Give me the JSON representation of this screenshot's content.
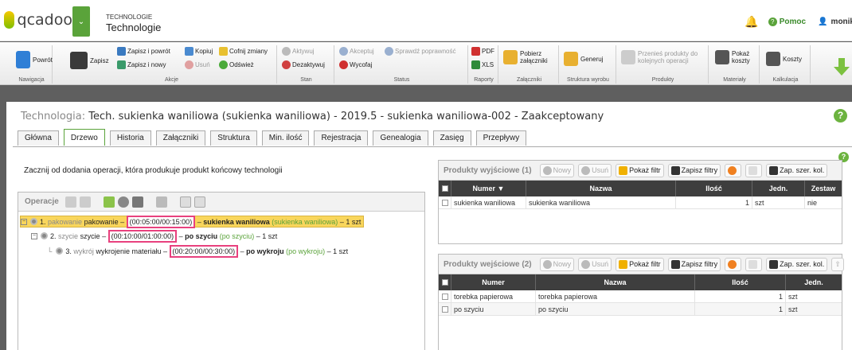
{
  "header": {
    "logo": "qcadoo",
    "category": "TECHNOLOGIE",
    "title": "Technologie",
    "help": "Pomoc",
    "user": "monik"
  },
  "ribbon": {
    "back": "Powrót",
    "save": "Zapisz",
    "save_back": "Zapisz i powrót",
    "save_new": "Zapisz i nowy",
    "copy": "Kopiuj",
    "delete": "Usuń",
    "undo": "Cofnij zmiany",
    "refresh": "Odśwież",
    "active": "Aktywuj",
    "deactivate": "Dezaktywuj",
    "accept": "Akceptuj",
    "check": "Sprawdź poprawność",
    "withdraw": "Wycofaj",
    "pdf": "PDF",
    "xls": "XLS",
    "download": "Pobierz załączniki",
    "generate": "Generuj",
    "move": "Przenieś produkty do kolejnych operacji",
    "show_costs": "Pokaż koszty",
    "costs": "Koszty",
    "groups": {
      "nav": "Nawigacja",
      "actions": "Akcje",
      "state": "Stan",
      "status": "Status",
      "reports": "Raporty",
      "attachments": "Załączniki",
      "structure": "Struktura wyrobu",
      "products": "Produkty",
      "materials": "Materiały",
      "calc": "Kalkulacja"
    }
  },
  "page": {
    "title_label": "Technologia:",
    "title_value": "Tech. sukienka waniliowa (sukienka waniliowa) - 2019.5 - sukienka waniliowa-002 - Zaakceptowany"
  },
  "tabs": [
    "Główna",
    "Drzewo",
    "Historia",
    "Załączniki",
    "Struktura",
    "Min. ilość",
    "Rejestracja",
    "Genealogia",
    "Zasięg",
    "Przepływy"
  ],
  "intro": "Zacznij od dodania operacji, która produkuje produkt końcowy technologii",
  "operations": {
    "title": "Operacje",
    "nodes": [
      {
        "num": "1.",
        "code": "pakowanie",
        "name": "pakowanie",
        "dur": "(00:05:00/00:15:00)",
        "product": "sukienka waniliowa",
        "product_paren": "(sukienka waniliowa)",
        "qty": "– 1 szt"
      },
      {
        "num": "2.",
        "code": "szycie",
        "name": "szycie",
        "dur": "(00:10:00/01:00:00)",
        "product": "po szyciu",
        "product_paren": "(po szyciu)",
        "qty": "– 1 szt"
      },
      {
        "num": "3.",
        "code": "wykrój",
        "name": "wykrojenie materiału",
        "dur": "(00:20:00/00:30:00)",
        "product": "po wykroju",
        "product_paren": "(po wykroju)",
        "qty": "– 1 szt"
      }
    ]
  },
  "out_products": {
    "title": "Produkty wyjściowe",
    "count": "(1)",
    "new": "Nowy",
    "delete": "Usuń",
    "filter": "Pokaż filtr",
    "save_filters": "Zapisz filtry",
    "save_cols": "Zap. szer. kol.",
    "columns": [
      "Numer",
      "Nazwa",
      "Ilość",
      "Jedn.",
      "Zestaw"
    ],
    "rows": [
      [
        "sukienka waniliowa",
        "sukienka waniliowa",
        "1",
        "szt",
        "nie"
      ]
    ]
  },
  "in_products": {
    "title": "Produkty wejściowe",
    "count": "(2)",
    "new": "Nowy",
    "delete": "Usuń",
    "filter": "Pokaż filtr",
    "save_filters": "Zapisz filtry",
    "save_cols": "Zap. szer. kol.",
    "columns": [
      "Numer",
      "Nazwa",
      "Ilość",
      "Jedn."
    ],
    "rows": [
      [
        "torebka papierowa",
        "torebka papierowa",
        "1",
        "szt"
      ],
      [
        "po szyciu",
        "po szyciu",
        "1",
        "szt"
      ]
    ]
  }
}
